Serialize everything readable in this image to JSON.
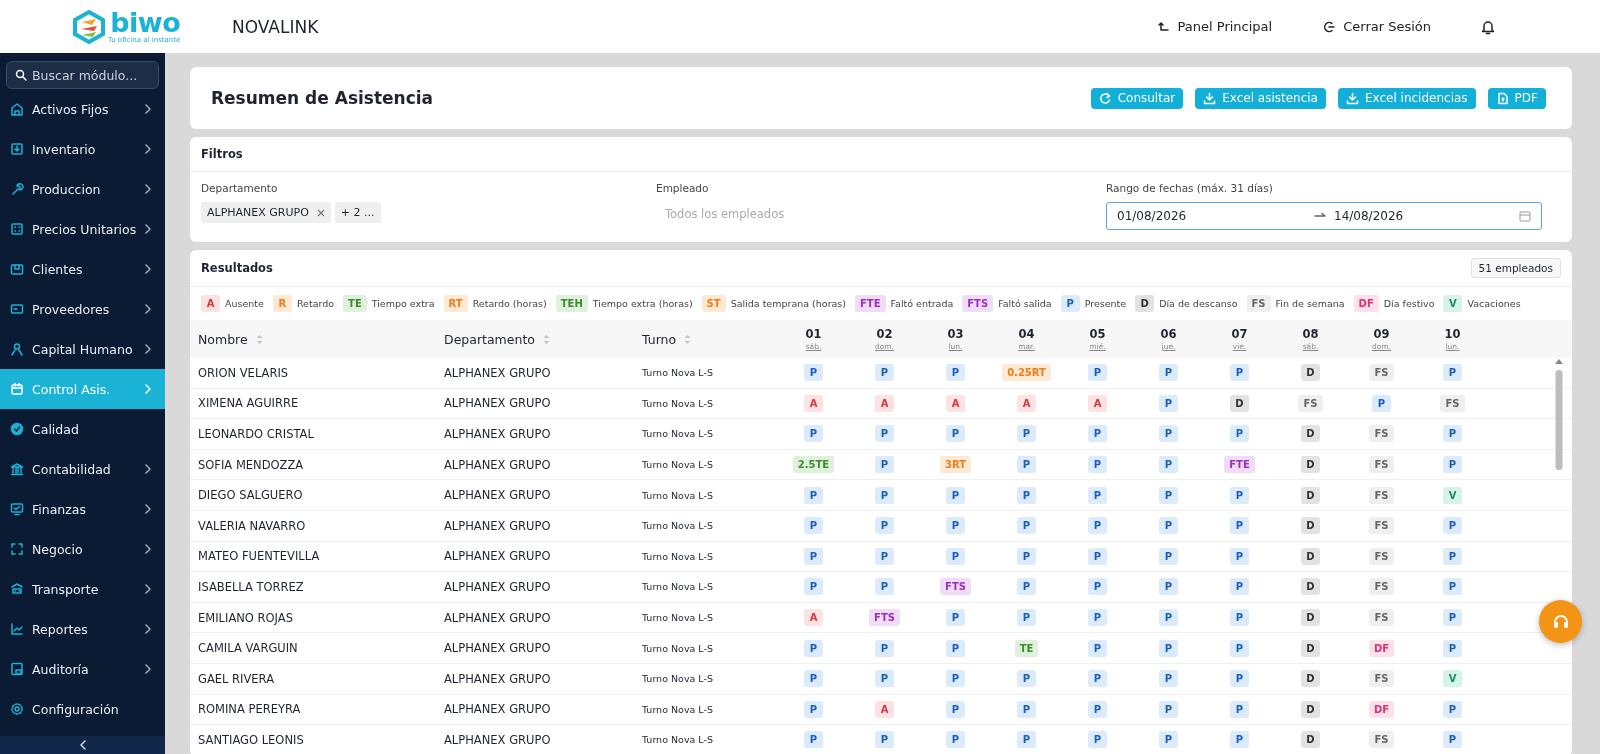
{
  "header": {
    "logo": {
      "name": "biwo",
      "tagline": "Tu oficina al instante"
    },
    "company": "NOVALINK",
    "links": [
      {
        "label": "Panel Principal",
        "kind": "back"
      },
      {
        "label": "Cerrar Sesión",
        "kind": "logout"
      }
    ]
  },
  "sidebar": {
    "search": {
      "placeholder": "Buscar módulo..."
    },
    "items": [
      {
        "label": "Activos Fijos",
        "expandable": true,
        "selected": false
      },
      {
        "label": "Inventario",
        "expandable": true,
        "selected": false
      },
      {
        "label": "Produccion",
        "expandable": true,
        "selected": false
      },
      {
        "label": "Precios Unitarios",
        "expandable": true,
        "selected": false
      },
      {
        "label": "Clientes",
        "expandable": true,
        "selected": false
      },
      {
        "label": "Proveedores",
        "expandable": true,
        "selected": false
      },
      {
        "label": "Capital Humano",
        "expandable": true,
        "selected": false
      },
      {
        "label": "Control Asis.",
        "expandable": true,
        "selected": true
      },
      {
        "label": "Calidad",
        "expandable": false,
        "selected": false
      },
      {
        "label": "Contabilidad",
        "expandable": true,
        "selected": false
      },
      {
        "label": "Finanzas",
        "expandable": true,
        "selected": false
      },
      {
        "label": "Negocio",
        "expandable": true,
        "selected": false
      },
      {
        "label": "Transporte",
        "expandable": true,
        "selected": false
      },
      {
        "label": "Reportes",
        "expandable": true,
        "selected": false
      },
      {
        "label": "Auditoría",
        "expandable": true,
        "selected": false
      },
      {
        "label": "Configuración",
        "expandable": false,
        "selected": false
      }
    ]
  },
  "page": {
    "title": "Resumen de Asistencia",
    "actions": [
      {
        "label": "Consultar",
        "kind": "refresh"
      },
      {
        "label": "Excel asistencia",
        "kind": "download"
      },
      {
        "label": "Excel incidencias",
        "kind": "download"
      },
      {
        "label": "PDF",
        "kind": "file"
      }
    ]
  },
  "filters": {
    "title": "Filtros",
    "department": {
      "label": "Departamento",
      "tags": [
        "ALPHANEX GRUPO"
      ],
      "more": "+ 2 ..."
    },
    "employee": {
      "label": "Empleado",
      "placeholder": "Todos los empleados"
    },
    "date_range": {
      "label": "Rango de fechas (máx. 31 días)",
      "start": "01/08/2026",
      "end": "14/08/2026",
      "focused": true
    }
  },
  "results": {
    "title": "Resultados",
    "count": "51 empleados",
    "legend": [
      {
        "code": "A",
        "label": "Ausente",
        "kind": "absent"
      },
      {
        "code": "R",
        "label": "Retardo",
        "kind": "late"
      },
      {
        "code": "TE",
        "label": "Tiempo extra",
        "kind": "overtime"
      },
      {
        "code": "RT",
        "label": "Retardo (horas)",
        "kind": "late"
      },
      {
        "code": "TEH",
        "label": "Tiempo extra (horas)",
        "kind": "overtime"
      },
      {
        "code": "ST",
        "label": "Salida temprana (horas)",
        "kind": "late"
      },
      {
        "code": "FTE",
        "label": "Faltó entrada",
        "kind": "missed"
      },
      {
        "code": "FTS",
        "label": "Faltó salida",
        "kind": "missed"
      },
      {
        "code": "P",
        "label": "Presente",
        "kind": "present"
      },
      {
        "code": "D",
        "label": "Día de descanso",
        "kind": "rest"
      },
      {
        "code": "FS",
        "label": "Fin de semana",
        "kind": "weekend"
      },
      {
        "code": "DF",
        "label": "Día festivo",
        "kind": "holiday"
      },
      {
        "code": "V",
        "label": "Vacaciones",
        "kind": "vacation"
      }
    ],
    "columns": [
      "Nombre",
      "Departamento",
      "Turno"
    ],
    "days": [
      {
        "day": "01",
        "weekday": "sáb."
      },
      {
        "day": "02",
        "weekday": "dom."
      },
      {
        "day": "03",
        "weekday": "lun."
      },
      {
        "day": "04",
        "weekday": "mar."
      },
      {
        "day": "05",
        "weekday": "mié."
      },
      {
        "day": "06",
        "weekday": "jue."
      },
      {
        "day": "07",
        "weekday": "vie."
      },
      {
        "day": "08",
        "weekday": "sáb."
      },
      {
        "day": "09",
        "weekday": "dom."
      },
      {
        "day": "10",
        "weekday": "lun."
      }
    ],
    "rows": [
      {
        "name": "ORION VELARIS",
        "department": "ALPHANEX GRUPO",
        "shift": "Turno Nova L-S",
        "cells": [
          {
            "code": "P",
            "kind": "present"
          },
          {
            "code": "P",
            "kind": "present"
          },
          {
            "code": "P",
            "kind": "present"
          },
          {
            "code": "0.25RT",
            "kind": "late"
          },
          {
            "code": "P",
            "kind": "present"
          },
          {
            "code": "P",
            "kind": "present"
          },
          {
            "code": "P",
            "kind": "present"
          },
          {
            "code": "D",
            "kind": "rest"
          },
          {
            "code": "FS",
            "kind": "weekend"
          },
          {
            "code": "P",
            "kind": "present"
          }
        ]
      },
      {
        "name": "XIMENA AGUIRRE",
        "department": "ALPHANEX GRUPO",
        "shift": "Turno Nova L-S",
        "cells": [
          {
            "code": "A",
            "kind": "absent"
          },
          {
            "code": "A",
            "kind": "absent"
          },
          {
            "code": "A",
            "kind": "absent"
          },
          {
            "code": "A",
            "kind": "absent"
          },
          {
            "code": "A",
            "kind": "absent"
          },
          {
            "code": "P",
            "kind": "present"
          },
          {
            "code": "D",
            "kind": "rest"
          },
          {
            "code": "FS",
            "kind": "weekend"
          },
          {
            "code": "P",
            "kind": "present"
          },
          {
            "code": "FS",
            "kind": "weekend"
          }
        ]
      },
      {
        "name": "LEONARDO CRISTAL",
        "department": "ALPHANEX GRUPO",
        "shift": "Turno Nova L-S",
        "cells": [
          {
            "code": "P",
            "kind": "present"
          },
          {
            "code": "P",
            "kind": "present"
          },
          {
            "code": "P",
            "kind": "present"
          },
          {
            "code": "P",
            "kind": "present"
          },
          {
            "code": "P",
            "kind": "present"
          },
          {
            "code": "P",
            "kind": "present"
          },
          {
            "code": "P",
            "kind": "present"
          },
          {
            "code": "D",
            "kind": "rest"
          },
          {
            "code": "FS",
            "kind": "weekend"
          },
          {
            "code": "P",
            "kind": "present"
          }
        ]
      },
      {
        "name": "SOFIA MENDOZZA",
        "department": "ALPHANEX GRUPO",
        "shift": "Turno Nova L-S",
        "cells": [
          {
            "code": "2.5TE",
            "kind": "overtime"
          },
          {
            "code": "P",
            "kind": "present"
          },
          {
            "code": "3RT",
            "kind": "late"
          },
          {
            "code": "P",
            "kind": "present"
          },
          {
            "code": "P",
            "kind": "present"
          },
          {
            "code": "P",
            "kind": "present"
          },
          {
            "code": "FTE",
            "kind": "missed"
          },
          {
            "code": "D",
            "kind": "rest"
          },
          {
            "code": "FS",
            "kind": "weekend"
          },
          {
            "code": "P",
            "kind": "present"
          }
        ]
      },
      {
        "name": "DIEGO SALGUERO",
        "department": "ALPHANEX GRUPO",
        "shift": "Turno Nova L-S",
        "cells": [
          {
            "code": "P",
            "kind": "present"
          },
          {
            "code": "P",
            "kind": "present"
          },
          {
            "code": "P",
            "kind": "present"
          },
          {
            "code": "P",
            "kind": "present"
          },
          {
            "code": "P",
            "kind": "present"
          },
          {
            "code": "P",
            "kind": "present"
          },
          {
            "code": "P",
            "kind": "present"
          },
          {
            "code": "D",
            "kind": "rest"
          },
          {
            "code": "FS",
            "kind": "weekend"
          },
          {
            "code": "V",
            "kind": "vacation"
          }
        ]
      },
      {
        "name": "VALERIA NAVARRO",
        "department": "ALPHANEX GRUPO",
        "shift": "Turno Nova L-S",
        "cells": [
          {
            "code": "P",
            "kind": "present"
          },
          {
            "code": "P",
            "kind": "present"
          },
          {
            "code": "P",
            "kind": "present"
          },
          {
            "code": "P",
            "kind": "present"
          },
          {
            "code": "P",
            "kind": "present"
          },
          {
            "code": "P",
            "kind": "present"
          },
          {
            "code": "P",
            "kind": "present"
          },
          {
            "code": "D",
            "kind": "rest"
          },
          {
            "code": "FS",
            "kind": "weekend"
          },
          {
            "code": "P",
            "kind": "present"
          }
        ]
      },
      {
        "name": "MATEO FUENTEVILLA",
        "department": "ALPHANEX GRUPO",
        "shift": "Turno Nova L-S",
        "cells": [
          {
            "code": "P",
            "kind": "present"
          },
          {
            "code": "P",
            "kind": "present"
          },
          {
            "code": "P",
            "kind": "present"
          },
          {
            "code": "P",
            "kind": "present"
          },
          {
            "code": "P",
            "kind": "present"
          },
          {
            "code": "P",
            "kind": "present"
          },
          {
            "code": "P",
            "kind": "present"
          },
          {
            "code": "D",
            "kind": "rest"
          },
          {
            "code": "FS",
            "kind": "weekend"
          },
          {
            "code": "P",
            "kind": "present"
          }
        ]
      },
      {
        "name": "ISABELLA TORREZ",
        "department": "ALPHANEX GRUPO",
        "shift": "Turno Nova L-S",
        "cells": [
          {
            "code": "P",
            "kind": "present"
          },
          {
            "code": "P",
            "kind": "present"
          },
          {
            "code": "FTS",
            "kind": "missed"
          },
          {
            "code": "P",
            "kind": "present"
          },
          {
            "code": "P",
            "kind": "present"
          },
          {
            "code": "P",
            "kind": "present"
          },
          {
            "code": "P",
            "kind": "present"
          },
          {
            "code": "D",
            "kind": "rest"
          },
          {
            "code": "FS",
            "kind": "weekend"
          },
          {
            "code": "P",
            "kind": "present"
          }
        ]
      },
      {
        "name": "EMILIANO ROJAS",
        "department": "ALPHANEX GRUPO",
        "shift": "Turno Nova L-S",
        "cells": [
          {
            "code": "A",
            "kind": "absent"
          },
          {
            "code": "FTS",
            "kind": "missed"
          },
          {
            "code": "P",
            "kind": "present"
          },
          {
            "code": "P",
            "kind": "present"
          },
          {
            "code": "P",
            "kind": "present"
          },
          {
            "code": "P",
            "kind": "present"
          },
          {
            "code": "P",
            "kind": "present"
          },
          {
            "code": "D",
            "kind": "rest"
          },
          {
            "code": "FS",
            "kind": "weekend"
          },
          {
            "code": "P",
            "kind": "present"
          }
        ]
      },
      {
        "name": "CAMILA VARGUIN",
        "department": "ALPHANEX GRUPO",
        "shift": "Turno Nova L-S",
        "cells": [
          {
            "code": "P",
            "kind": "present"
          },
          {
            "code": "P",
            "kind": "present"
          },
          {
            "code": "P",
            "kind": "present"
          },
          {
            "code": "TE",
            "kind": "overtime"
          },
          {
            "code": "P",
            "kind": "present"
          },
          {
            "code": "P",
            "kind": "present"
          },
          {
            "code": "P",
            "kind": "present"
          },
          {
            "code": "D",
            "kind": "rest"
          },
          {
            "code": "DF",
            "kind": "holiday"
          },
          {
            "code": "P",
            "kind": "present"
          }
        ]
      },
      {
        "name": "GAEL RIVERA",
        "department": "ALPHANEX GRUPO",
        "shift": "Turno Nova L-S",
        "cells": [
          {
            "code": "P",
            "kind": "present"
          },
          {
            "code": "P",
            "kind": "present"
          },
          {
            "code": "P",
            "kind": "present"
          },
          {
            "code": "P",
            "kind": "present"
          },
          {
            "code": "P",
            "kind": "present"
          },
          {
            "code": "P",
            "kind": "present"
          },
          {
            "code": "P",
            "kind": "present"
          },
          {
            "code": "D",
            "kind": "rest"
          },
          {
            "code": "FS",
            "kind": "weekend"
          },
          {
            "code": "V",
            "kind": "vacation"
          }
        ]
      },
      {
        "name": "ROMINA PEREYRA",
        "department": "ALPHANEX GRUPO",
        "shift": "Turno Nova L-S",
        "cells": [
          {
            "code": "P",
            "kind": "present"
          },
          {
            "code": "A",
            "kind": "absent"
          },
          {
            "code": "P",
            "kind": "present"
          },
          {
            "code": "P",
            "kind": "present"
          },
          {
            "code": "P",
            "kind": "present"
          },
          {
            "code": "P",
            "kind": "present"
          },
          {
            "code": "P",
            "kind": "present"
          },
          {
            "code": "D",
            "kind": "rest"
          },
          {
            "code": "DF",
            "kind": "holiday"
          },
          {
            "code": "P",
            "kind": "present"
          }
        ]
      },
      {
        "name": "SANTIAGO LEONIS",
        "department": "ALPHANEX GRUPO",
        "shift": "Turno Nova L-S",
        "cells": [
          {
            "code": "P",
            "kind": "present"
          },
          {
            "code": "P",
            "kind": "present"
          },
          {
            "code": "P",
            "kind": "present"
          },
          {
            "code": "P",
            "kind": "present"
          },
          {
            "code": "P",
            "kind": "present"
          },
          {
            "code": "P",
            "kind": "present"
          },
          {
            "code": "P",
            "kind": "present"
          },
          {
            "code": "D",
            "kind": "rest"
          },
          {
            "code": "FS",
            "kind": "weekend"
          },
          {
            "code": "P",
            "kind": "present"
          }
        ]
      }
    ]
  }
}
